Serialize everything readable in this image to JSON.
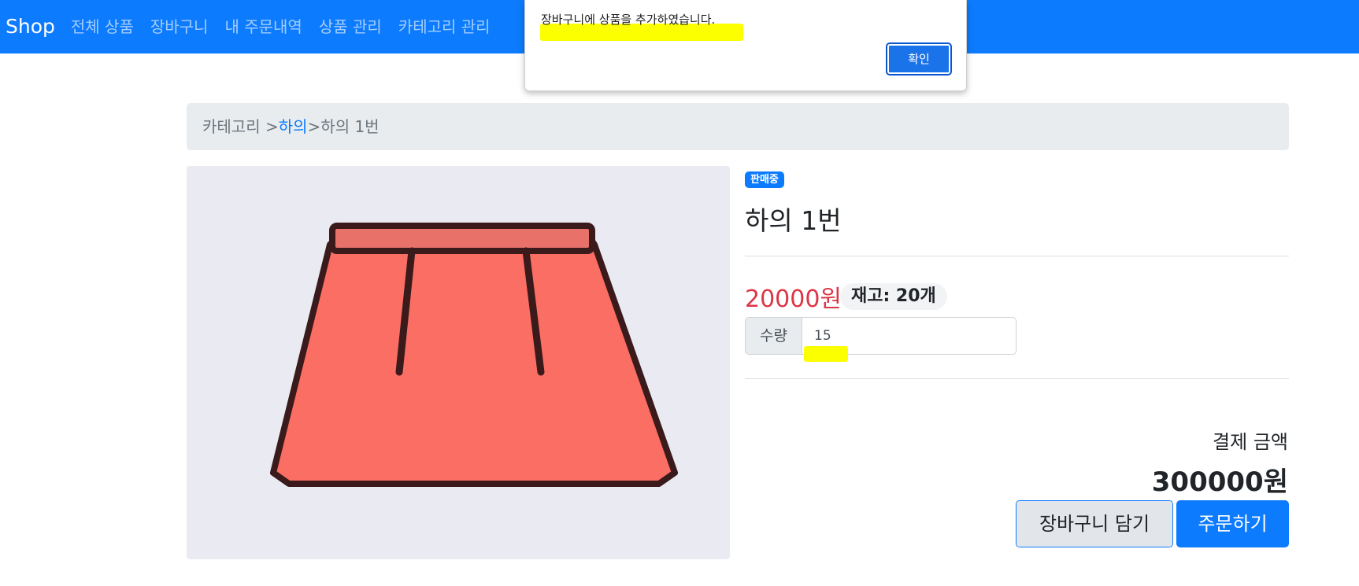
{
  "navbar": {
    "brand": "Shop",
    "links": [
      "전체 상품",
      "장바구니",
      "내 주문내역",
      "상품 관리",
      "카테고리 관리"
    ]
  },
  "alert": {
    "message": "장바구니에 상품을 추가하였습니다.",
    "ok_label": "확인"
  },
  "breadcrumb": {
    "root": "카테고리 >",
    "category": "하의",
    "separator": ">",
    "current": "하의 1번"
  },
  "product": {
    "image_icon": "skirt-icon",
    "status_badge": "판매중",
    "title": "하의 1번",
    "price": "20000원",
    "stock": "재고: 20개",
    "quantity_label": "수량",
    "quantity_value": "15"
  },
  "summary": {
    "total_label": "결제 금액",
    "total_amount": "300000원"
  },
  "actions": {
    "cart_label": "장바구니 담기",
    "order_label": "주문하기"
  },
  "colors": {
    "primary": "#0d7bfd",
    "price": "#dc3545",
    "highlight": "#fbff00",
    "skirt_fill": "#fa6e64"
  }
}
